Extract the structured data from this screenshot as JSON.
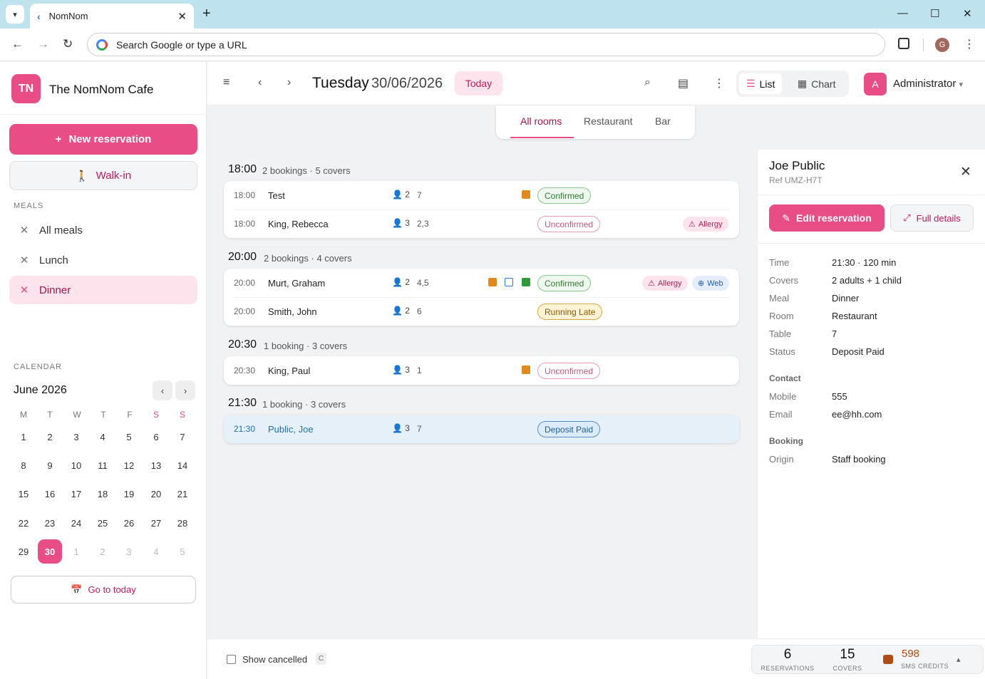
{
  "browser": {
    "tab_title": "NomNom",
    "omnibox_placeholder": "Search Google or type a URL",
    "profile_initial": "G"
  },
  "sidebar": {
    "logo_initials": "TN",
    "cafe_name": "The NomNom Cafe",
    "new_reservation_label": "New reservation",
    "walk_in_label": "Walk-in",
    "meals_heading": "MEALS",
    "meals": [
      {
        "label": "All meals",
        "icon": "utensils-icon"
      },
      {
        "label": "Lunch",
        "icon": "utensils-icon"
      },
      {
        "label": "Dinner",
        "icon": "utensils-icon",
        "active": true
      }
    ],
    "calendar_heading": "CALENDAR",
    "month_label": "June 2026",
    "weekdays": [
      "M",
      "T",
      "W",
      "T",
      "F",
      "S",
      "S"
    ],
    "weeks": [
      [
        "1",
        "2",
        "3",
        "4",
        "5",
        "6",
        "7"
      ],
      [
        "8",
        "9",
        "10",
        "11",
        "12",
        "13",
        "14"
      ],
      [
        "15",
        "16",
        "17",
        "18",
        "19",
        "20",
        "21"
      ],
      [
        "22",
        "23",
        "24",
        "25",
        "26",
        "27",
        "28"
      ],
      [
        "29",
        "30",
        "1",
        "2",
        "3",
        "4",
        "5"
      ]
    ],
    "selected_day": "30",
    "go_to_today_label": "Go to today"
  },
  "toolbar": {
    "day_name": "Tuesday",
    "date": "30/06/2026",
    "today_label": "Today",
    "view_list_label": "List",
    "view_chart_label": "Chart",
    "user_initial": "A",
    "user_name": "Administrator"
  },
  "room_tabs": [
    "All rooms",
    "Restaurant",
    "Bar"
  ],
  "groups": [
    {
      "time": "18:00",
      "bookings": "2 bookings",
      "covers": "5 covers"
    },
    {
      "time": "20:00",
      "bookings": "2 bookings",
      "covers": "4 covers"
    },
    {
      "time": "20:30",
      "bookings": "1 booking",
      "covers": "3 covers"
    },
    {
      "time": "21:30",
      "bookings": "1 booking",
      "covers": "3 covers"
    }
  ],
  "bookings": [
    {
      "time": "18:00",
      "name": "Test",
      "covers": "2",
      "table": "7",
      "status": "Confirmed"
    },
    {
      "time": "18:00",
      "name": "King, Rebecca",
      "covers": "3",
      "table": "2,3",
      "status": "Unconfirmed",
      "tag": "Allergy"
    },
    {
      "time": "20:00",
      "name": "Murt, Graham",
      "covers": "2",
      "table": "4,5",
      "status": "Confirmed",
      "tag": "Allergy",
      "source": "Web"
    },
    {
      "time": "20:00",
      "name": "Smith, John",
      "covers": "2",
      "table": "6",
      "status": "Running Late"
    },
    {
      "time": "20:30",
      "name": "King, Paul",
      "covers": "3",
      "table": "1",
      "status": "Unconfirmed"
    },
    {
      "time": "21:30",
      "name": "Public, Joe",
      "covers": "3",
      "table": "7",
      "status": "Deposit Paid"
    }
  ],
  "detail": {
    "name": "Joe Public",
    "ref": "Ref UMZ-H7T",
    "edit_label": "Edit reservation",
    "full_details_label": "Full details",
    "fields": [
      {
        "key": "Time",
        "value": "21:30 · 120 min"
      },
      {
        "key": "Covers",
        "value": "2 adults + 1 child"
      },
      {
        "key": "Meal",
        "value": "Dinner"
      },
      {
        "key": "Room",
        "value": "Restaurant"
      },
      {
        "key": "Table",
        "value": "7"
      },
      {
        "key": "Status",
        "value": "Deposit Paid"
      }
    ],
    "contact_heading": "Contact",
    "contact": [
      {
        "key": "Mobile",
        "value": "555"
      },
      {
        "key": "Email",
        "value": "ee@hh.com"
      }
    ],
    "booking_heading": "Booking",
    "booking": [
      {
        "key": "Origin",
        "value": "Staff booking"
      }
    ]
  },
  "footer": {
    "show_cancelled_label": "Show cancelled",
    "shortcut_key": "C",
    "reservations_count": "6",
    "reservations_label": "RESERVATIONS",
    "covers_count": "15",
    "covers_label": "COVERS",
    "sms_credits": "598",
    "sms_label": "SMS CREDITS"
  },
  "colors": {
    "accent": "#e84e85",
    "confirmed": "#2e7d32",
    "unconfirmed": "#c2577d",
    "running_late": "#8a5a00",
    "deposit_paid": "#1d5f99"
  }
}
